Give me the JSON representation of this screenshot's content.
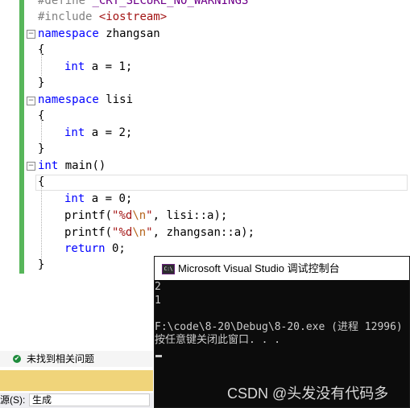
{
  "editor": {
    "line0": {
      "pp": "#define",
      "macro": " _CRT_SECURE_NO_WARNINGS"
    },
    "line1": {
      "pp": "#include",
      "header": " <iostream>"
    },
    "ns1": {
      "kw": "namespace",
      "name": " zhangsan"
    },
    "brace_open": "{",
    "brace_close": "}",
    "ns1_body": {
      "type": "int",
      "rest": " a = 1;"
    },
    "ns2": {
      "kw": "namespace",
      "name": " lisi"
    },
    "ns2_body": {
      "type": "int",
      "rest": " a = 2;"
    },
    "main_sig": {
      "type": "int",
      "rest": " main()"
    },
    "main_l1": {
      "type": "int",
      "rest": " a = 0;"
    },
    "main_l2": {
      "fn": "printf(",
      "str_open": "\"%d",
      "esc": "\\n",
      "str_close": "\"",
      "rest": ", lisi::a);"
    },
    "main_l3": {
      "fn": "printf(",
      "str_open": "\"%d",
      "esc": "\\n",
      "str_close": "\"",
      "rest": ", zhangsan::a);"
    },
    "main_l4": {
      "kw": "return",
      "rest": " 0;"
    },
    "fold_symbol": "−"
  },
  "status_bar": {
    "icon": "✔",
    "message": "未找到相关问题"
  },
  "output_panel": {
    "source_label": "源(S):",
    "source_value": "生成"
  },
  "console": {
    "icon_text": "C:\\",
    "title": "Microsoft Visual Studio 调试控制台",
    "lines": [
      "2",
      "1",
      "",
      "F:\\code\\8-20\\Debug\\8-20.exe (进程 12996)",
      "按任意键关闭此窗口. . ."
    ]
  },
  "watermark": "CSDN @头发没有代码多",
  "colors": {
    "keyword": "#0000ff",
    "preprocessor": "#808080",
    "string": "#a31515",
    "change_bar": "#57b65a",
    "console_bg": "#0c0c0c",
    "status_yellow": "#f0d47a"
  }
}
